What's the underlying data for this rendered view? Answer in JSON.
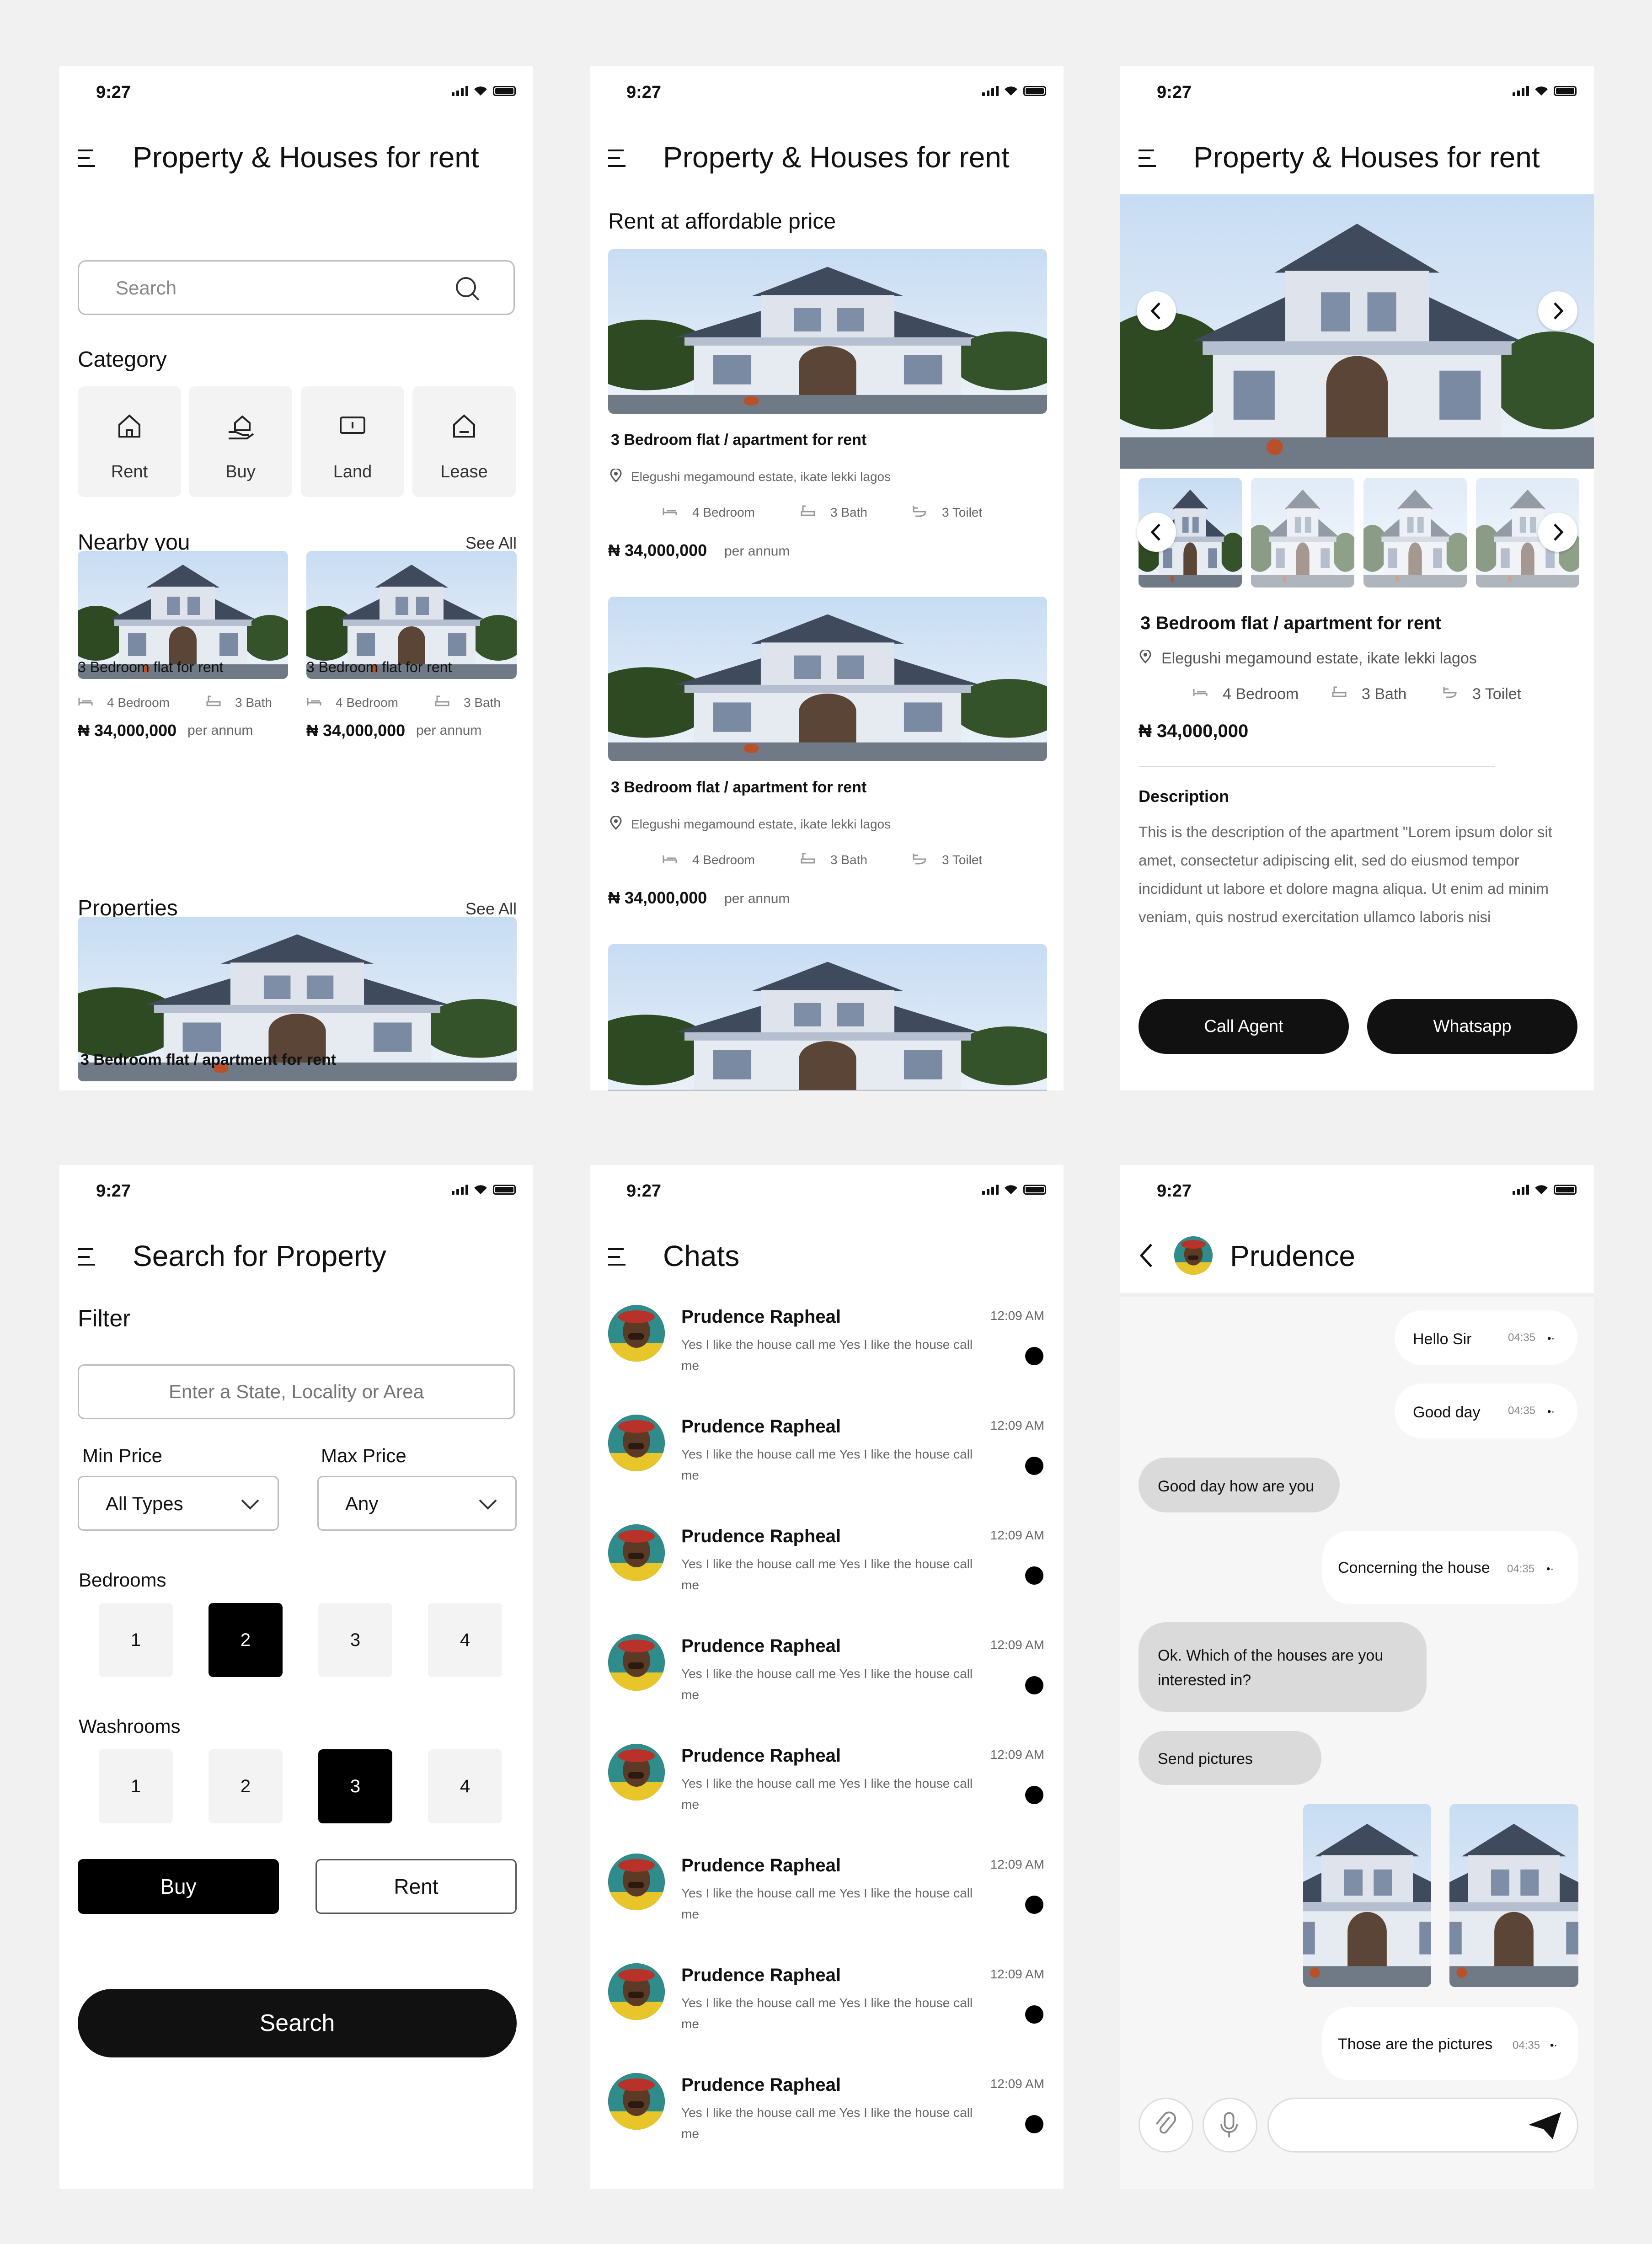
{
  "status": {
    "time": "9:27"
  },
  "screen1": {
    "title": "Property & Houses for rent",
    "search_placeholder": "Search",
    "category_title": "Category",
    "categories": [
      {
        "label": "Rent",
        "icon": "house-icon"
      },
      {
        "label": "Buy",
        "icon": "hand-house-icon"
      },
      {
        "label": "Land",
        "icon": "land-sign-icon"
      },
      {
        "label": "Lease",
        "icon": "house-icon"
      }
    ],
    "nearby_title": "Nearby you",
    "see_all": "See All",
    "nearby": [
      {
        "title": "3 Bedroom flat for rent",
        "bedroom": "4 Bedroom",
        "bath": "3 Bath",
        "price": "₦ 34,000,000",
        "period": "per annum"
      },
      {
        "title": "3 Bedroom flat for rent",
        "bedroom": "4 Bedroom",
        "bath": "3 Bath",
        "price": "₦ 34,000,000",
        "period": "per annum"
      }
    ],
    "properties_title": "Properties",
    "property_title": "3 Bedroom flat / apartment for rent"
  },
  "screen2": {
    "title": "Property & Houses for rent",
    "subtitle": "Rent at affordable price",
    "listings": [
      {
        "title": "3 Bedroom flat / apartment for rent",
        "location": "Elegushi megamound estate, ikate lekki lagos",
        "bedroom": "4 Bedroom",
        "bath": "3 Bath",
        "toilet": "3 Toilet",
        "price": "₦ 34,000,000",
        "period": "per annum"
      },
      {
        "title": "3 Bedroom flat / apartment for rent",
        "location": "Elegushi megamound estate, ikate lekki lagos",
        "bedroom": "4 Bedroom",
        "bath": "3 Bath",
        "toilet": "3 Toilet",
        "price": "₦ 34,000,000",
        "period": "per annum"
      }
    ]
  },
  "screen3": {
    "title": "Property & Houses for rent",
    "listing_title": "3 Bedroom flat / apartment for rent",
    "location": "Elegushi megamound estate, ikate lekki lagos",
    "bedroom": "4 Bedroom",
    "bath": "3 Bath",
    "toilet": "3 Toilet",
    "price": "₦ 34,000,000",
    "description_title": "Description",
    "description": "This is the description of the apartment \"Lorem ipsum dolor sit amet, consectetur adipiscing elit, sed do eiusmod tempor incididunt ut labore et dolore magna aliqua. Ut enim ad minim veniam, quis nostrud exercitation ullamco laboris nisi",
    "call_agent": "Call Agent",
    "whatsapp": "Whatsapp"
  },
  "screen4": {
    "title": "Search for Property",
    "filter_title": "Filter",
    "location_placeholder": "Enter a State, Locality or Area",
    "min_price_label": "Min Price",
    "min_price_value": "All Types",
    "max_price_label": "Max Price",
    "max_price_value": "Any",
    "bedrooms_label": "Bedrooms",
    "bedrooms": [
      "1",
      "2",
      "3",
      "4"
    ],
    "washrooms_label": "Washrooms",
    "washrooms": [
      "1",
      "2",
      "3",
      "4"
    ],
    "buy": "Buy",
    "rent": "Rent",
    "search": "Search"
  },
  "screen5": {
    "title": "Chats",
    "chats": [
      {
        "name": "Prudence Rapheal",
        "time": "12:09 AM",
        "message": "Yes I like the house call me Yes I like the house call me"
      },
      {
        "name": "Prudence Rapheal",
        "time": "12:09 AM",
        "message": "Yes I like the house call me Yes I like the house call me"
      },
      {
        "name": "Prudence Rapheal",
        "time": "12:09 AM",
        "message": "Yes I like the house call me Yes I like the house call me"
      },
      {
        "name": "Prudence Rapheal",
        "time": "12:09 AM",
        "message": "Yes I like the house call me Yes I like the house call me"
      },
      {
        "name": "Prudence Rapheal",
        "time": "12:09 AM",
        "message": "Yes I like the house call me Yes I like the house call me"
      },
      {
        "name": "Prudence Rapheal",
        "time": "12:09 AM",
        "message": "Yes I like the house call me Yes I like the house call me"
      },
      {
        "name": "Prudence Rapheal",
        "time": "12:09 AM",
        "message": "Yes I like the house call me Yes I like the house call me"
      },
      {
        "name": "Prudence Rapheal",
        "time": "12:09 AM",
        "message": "Yes I like the house call me Yes I like the house call me"
      }
    ]
  },
  "screen6": {
    "contact": "Prudence",
    "messages": [
      {
        "text": "Hello Sir",
        "time": "04:35",
        "from": "me"
      },
      {
        "text": "Good day",
        "time": "04:35",
        "from": "me"
      },
      {
        "text": "Good day how are you",
        "time": "",
        "from": "them"
      },
      {
        "text": "Concerning the house",
        "time": "04:35",
        "from": "me"
      },
      {
        "text": "Ok. Which of the houses are you interested in?",
        "time": "",
        "from": "them"
      },
      {
        "text": "Send pictures",
        "time": "",
        "from": "them"
      },
      {
        "text": "Those are the pictures",
        "time": "04:35",
        "from": "me"
      }
    ]
  }
}
